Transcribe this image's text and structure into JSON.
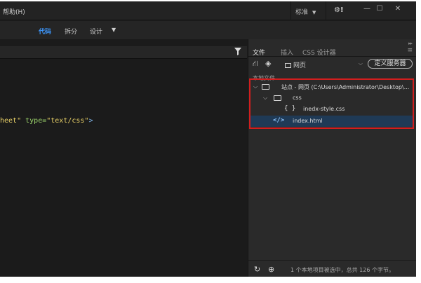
{
  "menubar": {
    "help_label": "帮助(H)",
    "workspace_label": "标准",
    "sync_label": "⚙!"
  },
  "view_tabs": [
    {
      "label": "代码",
      "active": true
    },
    {
      "label": "拆分",
      "active": false
    },
    {
      "label": "设计",
      "active": false
    }
  ],
  "code": {
    "prefix": "heet\"",
    "attr": " type=",
    "value": "\"text/css\"",
    "close": ">"
  },
  "panel": {
    "tabs": [
      {
        "label": "文件",
        "active": true
      },
      {
        "label": "插入",
        "active": false
      },
      {
        "label": "CSS 设计器",
        "active": false
      }
    ],
    "site_select": "网页",
    "define_server": "定义服务器",
    "local_files_label": "本地文件",
    "tree": [
      {
        "label": "站点 - 网页 (C:\\Users\\Administrator\\Desktop\\...",
        "type": "site",
        "depth": 0,
        "expanded": true
      },
      {
        "label": "css",
        "type": "folder",
        "depth": 1,
        "expanded": true
      },
      {
        "label": "inedx-style.css",
        "type": "css",
        "depth": 2
      },
      {
        "label": "index.html",
        "type": "html",
        "depth": 1,
        "selected": true
      }
    ],
    "status": "1 个本地项目被选中，总共 126 个字节。"
  },
  "colors": {
    "active_tab": "#3d98ff",
    "highlight_border": "#d21e1e",
    "selection": "#1f3a56"
  }
}
